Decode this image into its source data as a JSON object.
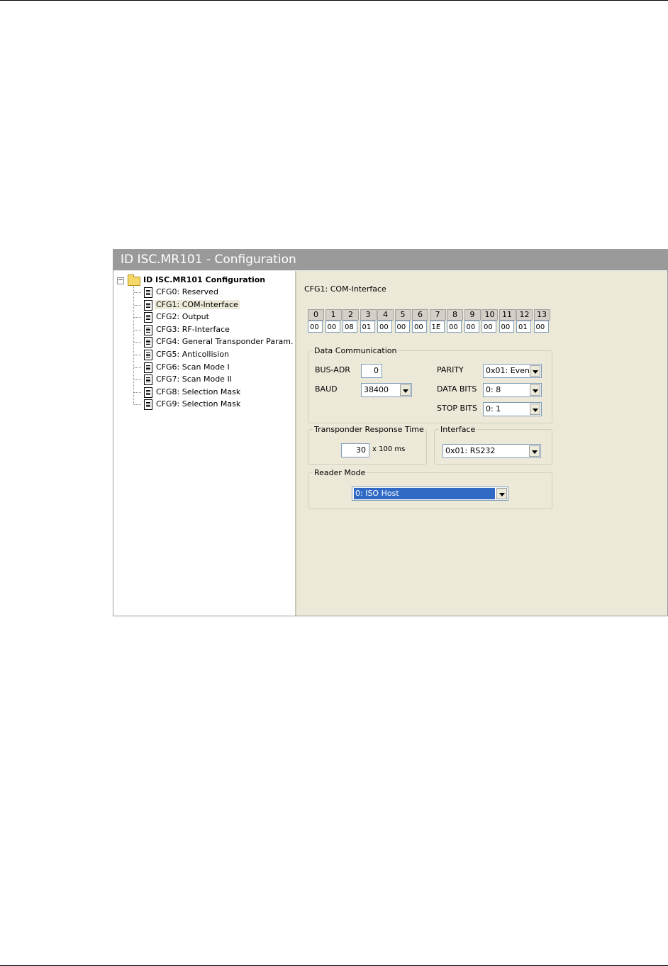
{
  "window": {
    "title": "ID ISC.MR101 - Configuration"
  },
  "tree": {
    "root_label": "ID ISC.MR101 Configuration",
    "items": [
      "CFG0: Reserved",
      "CFG1: COM-Interface",
      "CFG2: Output",
      "CFG3: RF-Interface",
      "CFG4: General Transponder Param.",
      "CFG5: Anticollision",
      "CFG6: Scan Mode I",
      "CFG7: Scan Mode II",
      "CFG8: Selection Mask",
      "CFG9: Selection Mask"
    ],
    "selected_index": 1
  },
  "panel": {
    "heading": "CFG1: COM-Interface",
    "byte_indices": [
      "0",
      "1",
      "2",
      "3",
      "4",
      "5",
      "6",
      "7",
      "8",
      "9",
      "10",
      "11",
      "12",
      "13"
    ],
    "byte_values": [
      "00",
      "00",
      "08",
      "01",
      "00",
      "00",
      "00",
      "1E",
      "00",
      "00",
      "00",
      "00",
      "01",
      "00"
    ],
    "data_comm": {
      "legend": "Data Communication",
      "bus_adr_label": "BUS-ADR",
      "bus_adr_value": "0",
      "baud_label": "BAUD",
      "baud_value": "38400",
      "parity_label": "PARITY",
      "parity_value": "0x01: Even",
      "data_bits_label": "DATA BITS",
      "data_bits_value": "0: 8",
      "stop_bits_label": "STOP BITS",
      "stop_bits_value": "0: 1"
    },
    "response_time": {
      "legend": "Transponder Response Time",
      "value": "30",
      "unit": "x 100 ms"
    },
    "interface": {
      "legend": "Interface",
      "value": "0x01: RS232"
    },
    "reader_mode": {
      "legend": "Reader Mode",
      "value": "0: ISO Host"
    }
  }
}
